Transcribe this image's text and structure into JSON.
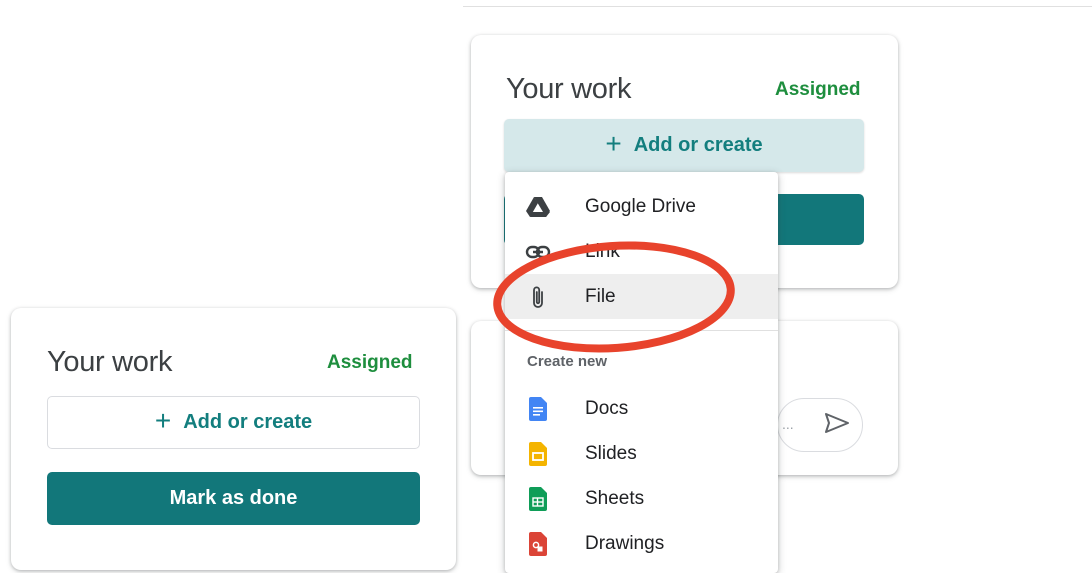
{
  "background_card": {
    "title": "Your work",
    "status": "Assigned",
    "add_label": "Add or create",
    "add_icon": "plus-icon",
    "send_icon": "send-icon",
    "input_overflow": "..."
  },
  "foreground_card": {
    "title": "Your work",
    "status": "Assigned",
    "add_label": "Add or create",
    "add_icon": "plus-icon",
    "done_label": "Mark as done"
  },
  "menu": {
    "items": [
      {
        "label": "Google Drive",
        "icon": "google-drive-icon"
      },
      {
        "label": "Link",
        "icon": "link-icon"
      },
      {
        "label": "File",
        "icon": "paperclip-icon",
        "highlighted": true
      }
    ],
    "section_label": "Create new",
    "create_items": [
      {
        "label": "Docs",
        "icon": "docs-icon",
        "color": "#4285f4"
      },
      {
        "label": "Slides",
        "icon": "slides-icon",
        "color": "#f4b400"
      },
      {
        "label": "Sheets",
        "icon": "sheets-icon",
        "color": "#0f9d58"
      },
      {
        "label": "Drawings",
        "icon": "drawings-icon",
        "color": "#db4437"
      }
    ]
  },
  "colors": {
    "accent_teal": "#12777a",
    "status_green": "#1e8e3e",
    "annotation_red": "#e8432c"
  }
}
